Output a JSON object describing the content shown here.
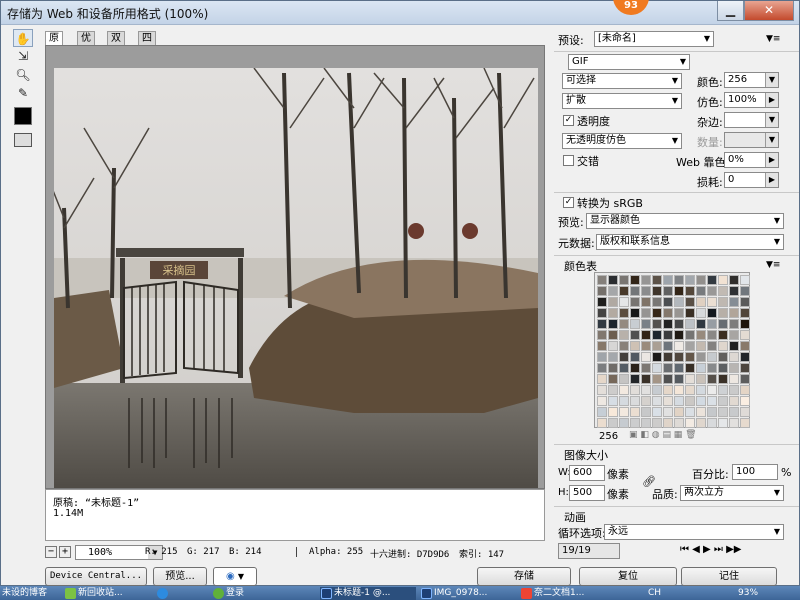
{
  "window": {
    "title": "存储为 Web 和设备所用格式 (100%)",
    "badge": "93",
    "min_icon": "minimize-icon",
    "close_icon": "close-icon"
  },
  "tools": [
    "hand-icon",
    "slice-select-icon",
    "zoom-icon",
    "eyedropper-icon",
    "eyedropper-color-swatch",
    "toggle-slice-visibility-icon"
  ],
  "tabs": [
    "原稿",
    "优化",
    "双联",
    "四联"
  ],
  "info": {
    "line1": "原稿: “未标题-1”",
    "line2": "1.14M"
  },
  "status": {
    "zoom": "100%",
    "r": "R: 215",
    "g": "G: 217",
    "b": "B: 214",
    "alpha": "Alpha: 255",
    "hex": "十六进制: D7D9D6",
    "index": "索引: 147"
  },
  "buttons": {
    "device_central": "Device Central...",
    "preview": "预览...",
    "save": "存储",
    "reset": "复位",
    "remember": "记住"
  },
  "preset": {
    "label": "预设:",
    "value": "[未命名]"
  },
  "format": "GIF",
  "reduction": "可选择",
  "dither_algo": "扩散",
  "transparency": {
    "label": "透明度",
    "checked": true
  },
  "transparency_dither": "无透明度仿色",
  "interlaced": {
    "label": "交错",
    "checked": false
  },
  "colors": {
    "label": "颜色:",
    "value": "256"
  },
  "dither": {
    "label": "仿色:",
    "value": "100%"
  },
  "matte": {
    "label": "杂边:",
    "value": ""
  },
  "amount": {
    "label": "数量:",
    "value": ""
  },
  "websnap": {
    "label": "Web 靠色:",
    "value": "0%"
  },
  "lossy": {
    "label": "损耗:",
    "value": "0"
  },
  "convert_srgb": {
    "label": "转换为 sRGB",
    "checked": true
  },
  "preview_row": {
    "label": "预览:",
    "value": "显示器颜色"
  },
  "metadata": {
    "label": "元数据:",
    "value": "版权和联系信息"
  },
  "color_table": {
    "title": "颜色表",
    "count": "256"
  },
  "image_size": {
    "title": "图像大小",
    "w_label": "W:",
    "w": "600",
    "h_label": "H:",
    "h": "500",
    "unit": "像素",
    "percent_label": "百分比:",
    "percent": "100",
    "percent_unit": "%",
    "quality_label": "品质:",
    "quality": "两次立方"
  },
  "animation": {
    "title": "动画",
    "loop_label": "循环选项:",
    "loop": "永远",
    "frames": "19/19"
  },
  "taskbar": [
    "未设的博客",
    "新回收站...",
    "",
    "登录",
    "未标题-1 @...",
    "IMG_0978...",
    "奈二文档1...",
    "93%",
    "CH"
  ]
}
